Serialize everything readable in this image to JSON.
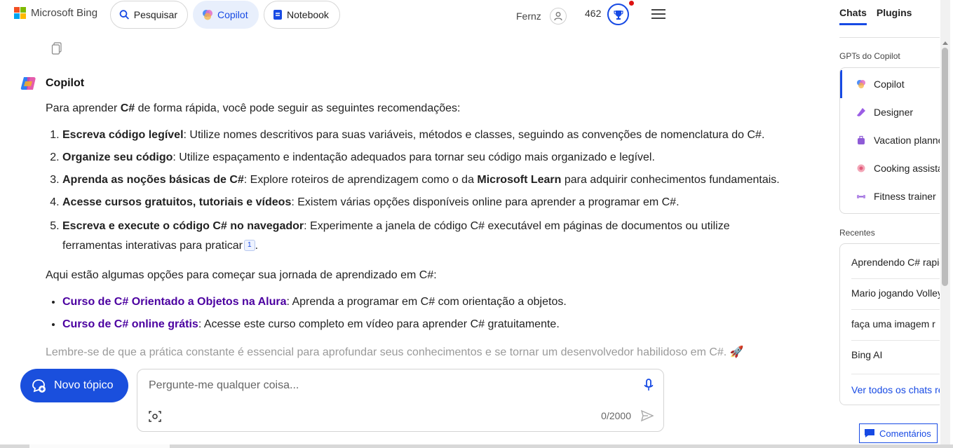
{
  "header": {
    "brand": "Microsoft Bing",
    "nav": [
      {
        "label": "Pesquisar",
        "icon": "search-icon"
      },
      {
        "label": "Copilot",
        "icon": "copilot-icon",
        "active": true
      },
      {
        "label": "Notebook",
        "icon": "notebook-icon"
      }
    ],
    "user_name": "Fernz",
    "points": "462"
  },
  "chat": {
    "assistant_name": "Copilot",
    "intro_pre": "Para aprender ",
    "intro_bold": "C#",
    "intro_post": " de forma rápida, você pode seguir as seguintes recomendações:",
    "tips": [
      {
        "bold": "Escreva código legível",
        "text": ": Utilize nomes descritivos para suas variáveis, métodos e classes, seguindo as convenções de nomenclatura do C#."
      },
      {
        "bold": "Organize seu código",
        "text": ": Utilize espaçamento e indentação adequados para tornar seu código mais organizado e legível."
      },
      {
        "bold": "Aprenda as noções básicas de C#",
        "text": ": Explore roteiros de aprendizagem como o da ",
        "bold2": "Microsoft Learn",
        "text2": " para adquirir conhecimentos fundamentais."
      },
      {
        "bold": "Acesse cursos gratuitos, tutoriais e vídeos",
        "text": ": Existem várias opções disponíveis online para aprender a programar em C#."
      },
      {
        "bold": "Escreva e execute o código C# no navegador",
        "text": ": Experimente a janela de código C# executável em páginas de documentos ou utilize ferramentas interativas para praticar",
        "cite": "1",
        "tail": "."
      }
    ],
    "options_intro": "Aqui estão algumas opções para começar sua jornada de aprendizado em C#:",
    "courses": [
      {
        "link": "Curso de C# Orientado a Objetos na Alura",
        "text": ": Aprenda a programar em C# com orientação a objetos."
      },
      {
        "link": "Curso de C# online grátis",
        "text": ": Acesse este curso completo em vídeo para aprender C# gratuitamente."
      }
    ],
    "closing": "Lembre-se de que a prática constante é essencial para aprofundar seus conhecimentos e se tornar um desenvolvedor habilidoso em C#. 🚀"
  },
  "composer": {
    "new_topic": "Novo tópico",
    "placeholder": "Pergunte-me qualquer coisa...",
    "counter": "0/2000"
  },
  "sidebar": {
    "tabs": [
      {
        "label": "Chats",
        "active": true
      },
      {
        "label": "Plugins",
        "active": false
      }
    ],
    "gpts_label": "GPTs do Copilot",
    "gpts": [
      {
        "label": "Copilot",
        "icon": "copilot-icon",
        "active": true
      },
      {
        "label": "Designer",
        "icon": "designer-icon"
      },
      {
        "label": "Vacation planner",
        "icon": "vacation-icon"
      },
      {
        "label": "Cooking assistant",
        "icon": "cooking-icon"
      },
      {
        "label": "Fitness trainer",
        "icon": "fitness-icon"
      }
    ],
    "recent_label": "Recentes",
    "recent": [
      "Aprendendo C# rapidamente",
      "Mario jogando Volley",
      "faça uma imagem r",
      "Bing AI"
    ],
    "see_all": "Ver todos os chats recentes"
  },
  "feedback": "Comentários",
  "colors": {
    "accent": "#174ae4",
    "link": "#4b00a0",
    "new_topic_bg": "#1a4fdd"
  }
}
